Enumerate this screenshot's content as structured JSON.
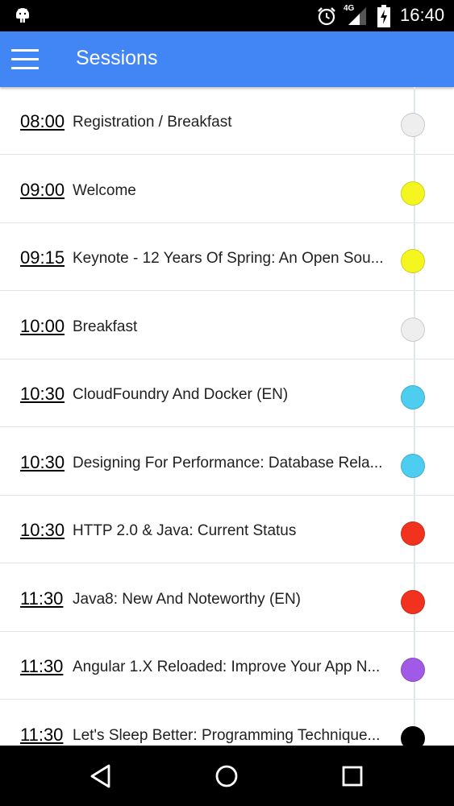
{
  "status": {
    "time": "16:40",
    "network": "4G"
  },
  "appbar": {
    "title": "Sessions"
  },
  "sessions": [
    {
      "time": "08:00",
      "title": "Registration / Breakfast",
      "color": "#eeeeee"
    },
    {
      "time": "09:00",
      "title": "Welcome",
      "color": "#f5f51f"
    },
    {
      "time": "09:15",
      "title": "Keynote - 12 Years Of Spring: An Open Sou...",
      "color": "#f5f51f"
    },
    {
      "time": "10:00",
      "title": "Breakfast",
      "color": "#eeeeee"
    },
    {
      "time": "10:30",
      "title": "CloudFoundry And Docker (EN)",
      "color": "#4dcdf0"
    },
    {
      "time": "10:30",
      "title": "Designing For Performance: Database Rela...",
      "color": "#4dcdf0"
    },
    {
      "time": "10:30",
      "title": "HTTP 2.0 & Java: Current Status",
      "color": "#f0321e"
    },
    {
      "time": "11:30",
      "title": "Java8: New And Noteworthy (EN)",
      "color": "#f0321e"
    },
    {
      "time": "11:30",
      "title": "Angular 1.X Reloaded: Improve Your App N...",
      "color": "#a15ae6"
    },
    {
      "time": "11:30",
      "title": "Let's Sleep Better: Programming Technique...",
      "color": "#000000"
    }
  ],
  "icons": {
    "android": "android-icon",
    "alarm": "alarm-icon",
    "signal": "signal-icon",
    "battery": "battery-charging-icon",
    "menu": "menu-icon",
    "back": "back-icon",
    "home": "home-icon",
    "recents": "recents-icon"
  }
}
